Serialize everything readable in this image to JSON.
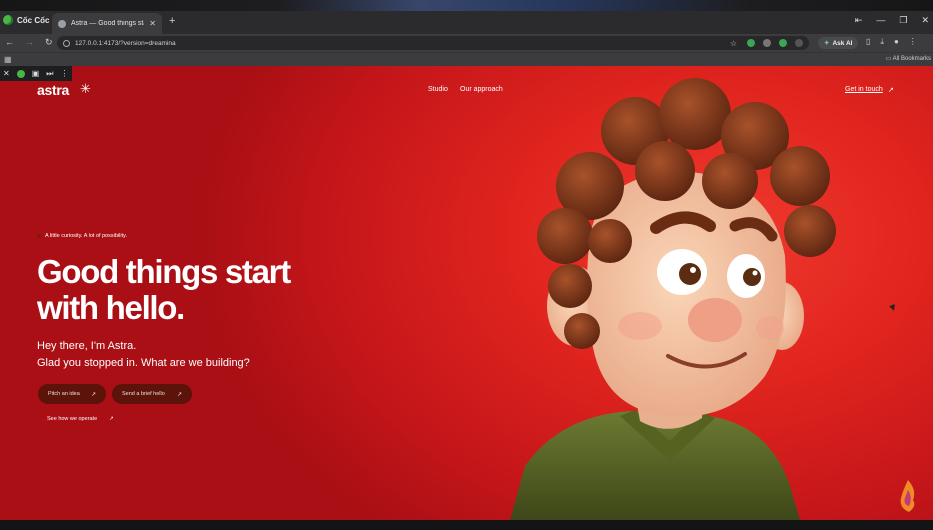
{
  "browser": {
    "brand": "Cốc Cốc",
    "tab_title": "Astra — Good things start w",
    "new_tab_icon": "plus-icon",
    "url": "127.0.0.1:4173/?version=dreamina",
    "ask_ai_label": "Ask AI",
    "all_bookmarks_label": "All Bookmarks"
  },
  "site": {
    "wordmark": "astra",
    "wordmark_symbol": "✳",
    "nav": [
      {
        "label": "Studio"
      },
      {
        "label": "Our approach"
      }
    ],
    "cta_link": "Get in touch",
    "cta_arrow": "↗"
  },
  "hero": {
    "eyebrow": "A little curiosity. A lot of possibility.",
    "headline_line1": "Good things start",
    "headline_line2": "with hello.",
    "subline1": "Hey there, I'm Astra.",
    "subline2": "Glad you stopped in. What are we building?",
    "buttons": [
      {
        "label": "Pitch an idea",
        "arrow": "↗"
      },
      {
        "label": "Send a brief hello",
        "arrow": "↗"
      }
    ],
    "secondary_link": "See how we operate",
    "secondary_arrow": "↗"
  },
  "colors": {
    "hero_red": "#e0241e",
    "button_bg": "#5b130a",
    "chrome_dark": "#2b2b2e",
    "hair": "#8a3b1b",
    "skin": "#f4c7a6",
    "shirt": "#5f6a2a"
  }
}
